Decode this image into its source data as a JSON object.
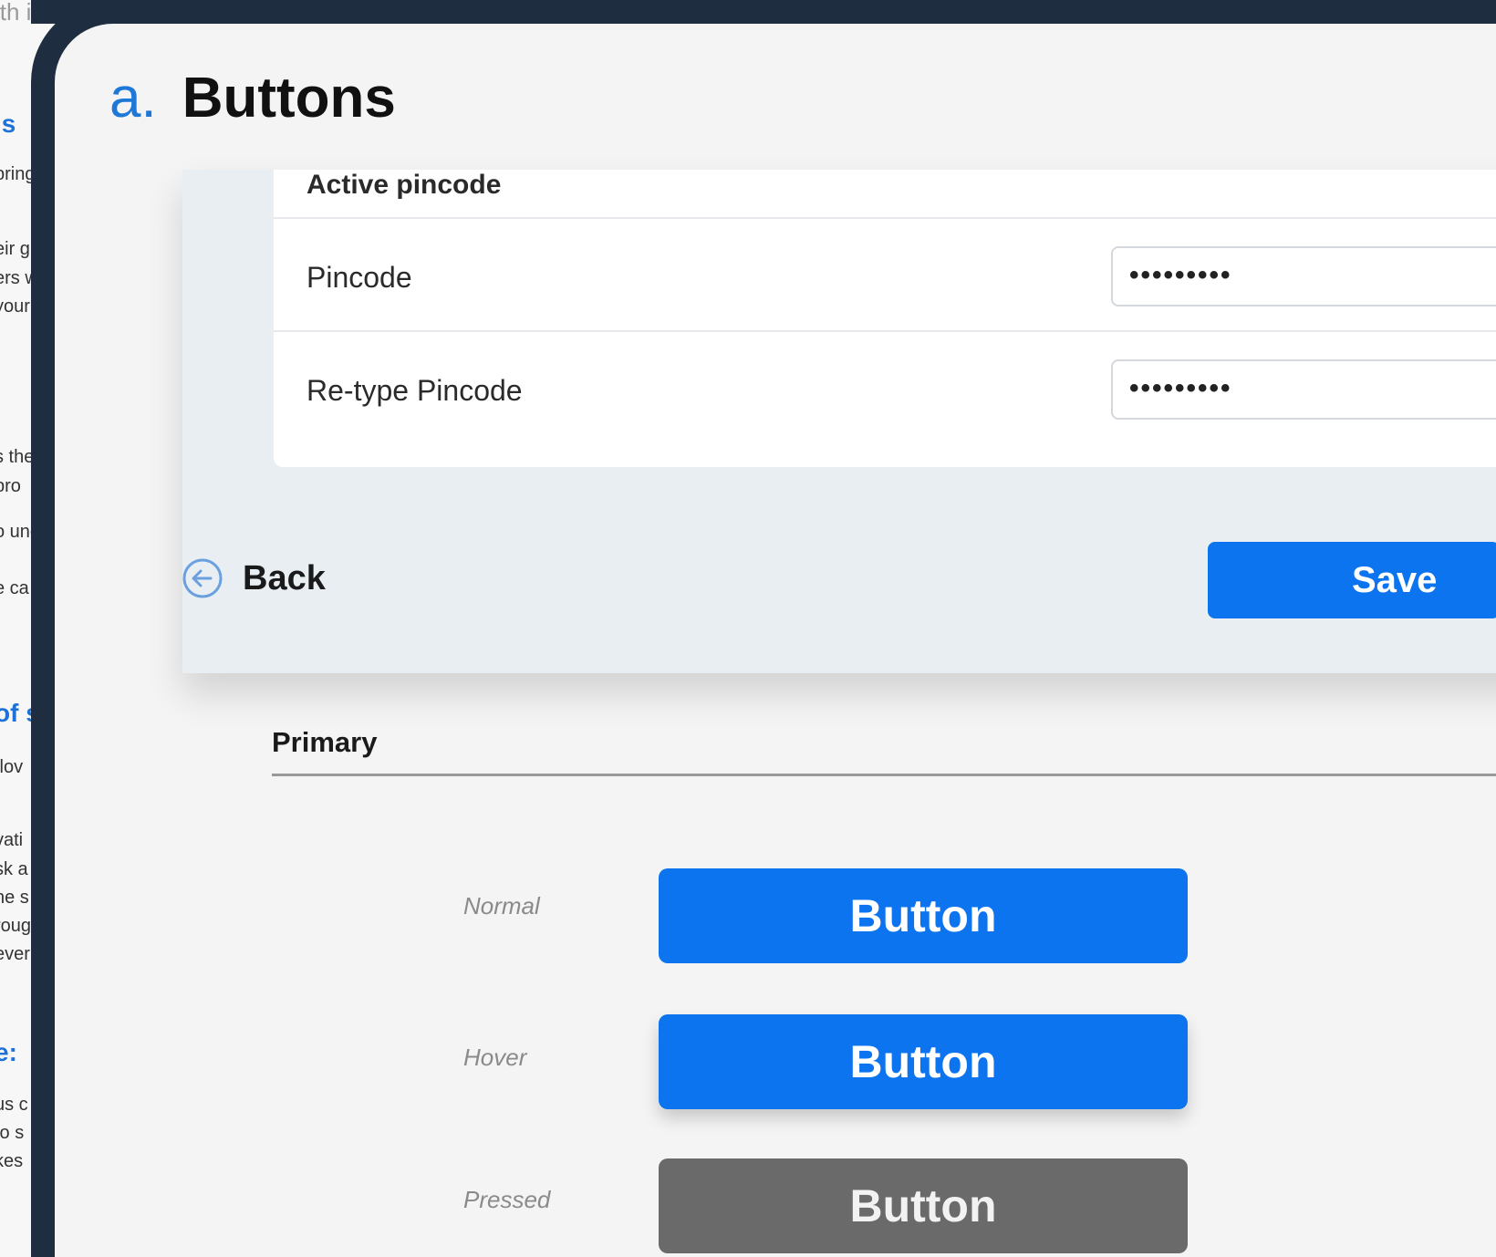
{
  "background_doc": {
    "lines": [
      {
        "text": "ith in",
        "style": "gray"
      },
      {
        "text": "ls",
        "style": "blue"
      },
      {
        "text": "pring",
        "style": "normal"
      },
      {
        "text": "eir g",
        "style": "normal"
      },
      {
        "text": "ers w",
        "style": "normal"
      },
      {
        "text": "your",
        "style": "normal"
      },
      {
        "text": "s the",
        "style": "normal"
      },
      {
        "text": "pro",
        "style": "normal"
      },
      {
        "text": "o und",
        "style": "normal"
      },
      {
        "text": "e ca",
        "style": "normal"
      },
      {
        "text": "of s",
        "style": "blue"
      },
      {
        "text": "flov",
        "style": "normal"
      },
      {
        "text": "vati",
        "style": "normal"
      },
      {
        "text": "sk a",
        "style": "normal"
      },
      {
        "text": "he s",
        "style": "normal"
      },
      {
        "text": "roug",
        "style": "normal"
      },
      {
        "text": "ever",
        "style": "normal"
      },
      {
        "text": "e:",
        "style": "blue"
      },
      {
        "text": "us c",
        "style": "normal"
      },
      {
        "text": "to s",
        "style": "normal"
      },
      {
        "text": "kes",
        "style": "normal"
      }
    ]
  },
  "heading": {
    "prefix": "a.",
    "title": "Buttons"
  },
  "form": {
    "partial_label": "Active pincode",
    "rows": [
      {
        "label": "Pincode",
        "value": "•••••••••"
      },
      {
        "label": "Re-type Pincode",
        "value": "•••••••••"
      }
    ],
    "back_label": "Back",
    "save_label": "Save"
  },
  "primary": {
    "section_title": "Primary",
    "states": [
      {
        "label": "Normal",
        "button_label": "Button"
      },
      {
        "label": "Hover",
        "button_label": "Button"
      },
      {
        "label": "Pressed",
        "button_label": "Button"
      }
    ]
  },
  "colors": {
    "primary": "#0d74f0",
    "pressed": "#6a6a6a",
    "frame": "#1e2d40",
    "heading_prefix": "#1e78d8"
  },
  "icons": {
    "back": "arrow-left-circle-icon"
  }
}
